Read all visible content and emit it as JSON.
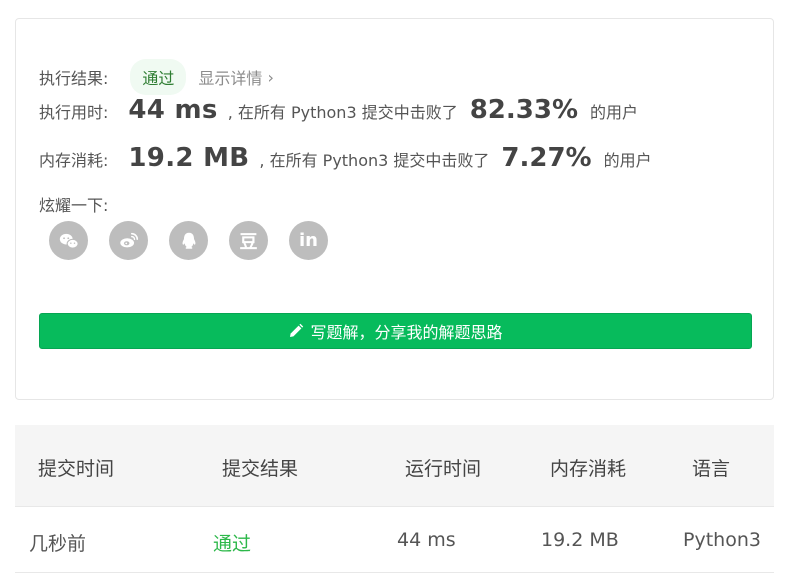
{
  "result": {
    "label": "执行结果:",
    "status": "通过",
    "details_link": "显示详情",
    "chevron": "›"
  },
  "runtime": {
    "label": "执行用时:",
    "value": "44 ms",
    "middle": ", 在所有 Python3 提交中击败了",
    "percent": "82.33%",
    "tail": "的用户"
  },
  "memory": {
    "label": "内存消耗:",
    "value": "19.2 MB",
    "middle": ", 在所有 Python3 提交中击败了",
    "percent": "7.27%",
    "tail": "的用户"
  },
  "share": {
    "label": "炫耀一下:",
    "icons": [
      "wechat-icon",
      "weibo-icon",
      "qq-icon",
      "douban-icon",
      "linkedin-icon"
    ],
    "douban_glyph": "豆",
    "linkedin_glyph": "in"
  },
  "write_button": {
    "label": "写题解，分享我的解题思路",
    "icon": "pencil-icon"
  },
  "submissions": {
    "headers": [
      "提交时间",
      "提交结果",
      "运行时间",
      "内存消耗",
      "语言"
    ],
    "rows": [
      [
        "几秒前",
        "通过",
        "44 ms",
        "19.2 MB",
        "Python3"
      ]
    ]
  },
  "colors": {
    "accent_green": "#07bb5c",
    "pass_text": "#2db84a",
    "icon_gray": "#bdbdbd"
  }
}
